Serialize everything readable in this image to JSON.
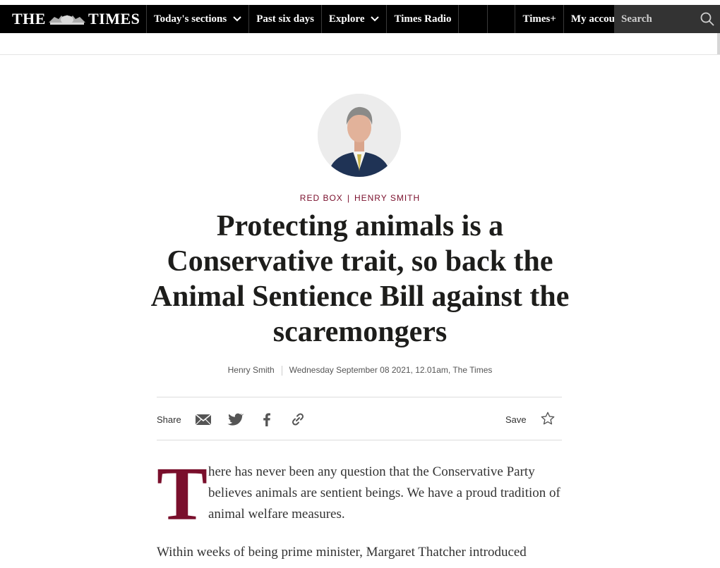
{
  "nav": {
    "logo_left": "THE",
    "logo_right": "TIMES",
    "items": [
      {
        "label": "Today's sections",
        "dropdown": true
      },
      {
        "label": "Past six days",
        "dropdown": false
      },
      {
        "label": "Explore",
        "dropdown": true
      },
      {
        "label": "Times Radio",
        "dropdown": false
      }
    ],
    "times_plus": "Times+",
    "account": "My account",
    "search_placeholder": "Search"
  },
  "article": {
    "kicker_section": "RED BOX",
    "kicker_author": "HENRY SMITH",
    "headline": "Protecting animals is a Conservative trait, so back the Animal Sentience Bill against the scaremongers",
    "byline_author": "Henry Smith",
    "byline_date": "Wednesday September 08 2021, 12.01am, The Times",
    "dropcap": "T",
    "para1": "here has never been any question that the Conservative Party believes animals are sentient beings. We have a proud tradition of animal welfare measures.",
    "para2": "Within weeks of being prime minister, Margaret Thatcher introduced"
  },
  "toolbar": {
    "share_label": "Share",
    "save_label": "Save"
  },
  "icons": {
    "share": [
      "email-icon",
      "twitter-icon",
      "facebook-icon",
      "link-icon"
    ],
    "save": "star-icon",
    "search": "search-icon"
  },
  "colors": {
    "nav_bg": "#000000",
    "search_bg": "#333333",
    "accent": "#7a0f2c",
    "text": "#1d1d1b"
  }
}
